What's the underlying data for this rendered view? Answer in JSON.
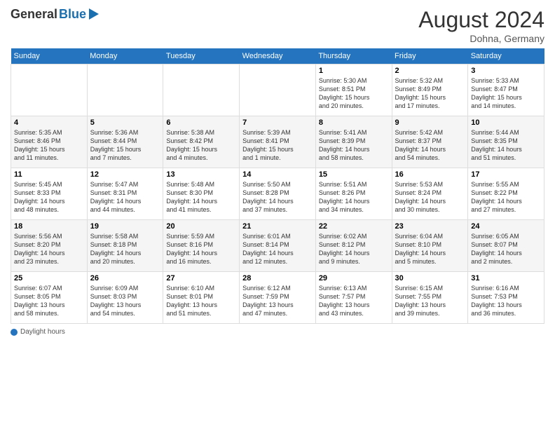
{
  "header": {
    "logo_general": "General",
    "logo_blue": "Blue",
    "title": "August 2024",
    "location": "Dohna, Germany"
  },
  "days_of_week": [
    "Sunday",
    "Monday",
    "Tuesday",
    "Wednesday",
    "Thursday",
    "Friday",
    "Saturday"
  ],
  "weeks": [
    [
      {
        "day": "",
        "info": ""
      },
      {
        "day": "",
        "info": ""
      },
      {
        "day": "",
        "info": ""
      },
      {
        "day": "",
        "info": ""
      },
      {
        "day": "1",
        "info": "Sunrise: 5:30 AM\nSunset: 8:51 PM\nDaylight: 15 hours\nand 20 minutes."
      },
      {
        "day": "2",
        "info": "Sunrise: 5:32 AM\nSunset: 8:49 PM\nDaylight: 15 hours\nand 17 minutes."
      },
      {
        "day": "3",
        "info": "Sunrise: 5:33 AM\nSunset: 8:47 PM\nDaylight: 15 hours\nand 14 minutes."
      }
    ],
    [
      {
        "day": "4",
        "info": "Sunrise: 5:35 AM\nSunset: 8:46 PM\nDaylight: 15 hours\nand 11 minutes."
      },
      {
        "day": "5",
        "info": "Sunrise: 5:36 AM\nSunset: 8:44 PM\nDaylight: 15 hours\nand 7 minutes."
      },
      {
        "day": "6",
        "info": "Sunrise: 5:38 AM\nSunset: 8:42 PM\nDaylight: 15 hours\nand 4 minutes."
      },
      {
        "day": "7",
        "info": "Sunrise: 5:39 AM\nSunset: 8:41 PM\nDaylight: 15 hours\nand 1 minute."
      },
      {
        "day": "8",
        "info": "Sunrise: 5:41 AM\nSunset: 8:39 PM\nDaylight: 14 hours\nand 58 minutes."
      },
      {
        "day": "9",
        "info": "Sunrise: 5:42 AM\nSunset: 8:37 PM\nDaylight: 14 hours\nand 54 minutes."
      },
      {
        "day": "10",
        "info": "Sunrise: 5:44 AM\nSunset: 8:35 PM\nDaylight: 14 hours\nand 51 minutes."
      }
    ],
    [
      {
        "day": "11",
        "info": "Sunrise: 5:45 AM\nSunset: 8:33 PM\nDaylight: 14 hours\nand 48 minutes."
      },
      {
        "day": "12",
        "info": "Sunrise: 5:47 AM\nSunset: 8:31 PM\nDaylight: 14 hours\nand 44 minutes."
      },
      {
        "day": "13",
        "info": "Sunrise: 5:48 AM\nSunset: 8:30 PM\nDaylight: 14 hours\nand 41 minutes."
      },
      {
        "day": "14",
        "info": "Sunrise: 5:50 AM\nSunset: 8:28 PM\nDaylight: 14 hours\nand 37 minutes."
      },
      {
        "day": "15",
        "info": "Sunrise: 5:51 AM\nSunset: 8:26 PM\nDaylight: 14 hours\nand 34 minutes."
      },
      {
        "day": "16",
        "info": "Sunrise: 5:53 AM\nSunset: 8:24 PM\nDaylight: 14 hours\nand 30 minutes."
      },
      {
        "day": "17",
        "info": "Sunrise: 5:55 AM\nSunset: 8:22 PM\nDaylight: 14 hours\nand 27 minutes."
      }
    ],
    [
      {
        "day": "18",
        "info": "Sunrise: 5:56 AM\nSunset: 8:20 PM\nDaylight: 14 hours\nand 23 minutes."
      },
      {
        "day": "19",
        "info": "Sunrise: 5:58 AM\nSunset: 8:18 PM\nDaylight: 14 hours\nand 20 minutes."
      },
      {
        "day": "20",
        "info": "Sunrise: 5:59 AM\nSunset: 8:16 PM\nDaylight: 14 hours\nand 16 minutes."
      },
      {
        "day": "21",
        "info": "Sunrise: 6:01 AM\nSunset: 8:14 PM\nDaylight: 14 hours\nand 12 minutes."
      },
      {
        "day": "22",
        "info": "Sunrise: 6:02 AM\nSunset: 8:12 PM\nDaylight: 14 hours\nand 9 minutes."
      },
      {
        "day": "23",
        "info": "Sunrise: 6:04 AM\nSunset: 8:10 PM\nDaylight: 14 hours\nand 5 minutes."
      },
      {
        "day": "24",
        "info": "Sunrise: 6:05 AM\nSunset: 8:07 PM\nDaylight: 14 hours\nand 2 minutes."
      }
    ],
    [
      {
        "day": "25",
        "info": "Sunrise: 6:07 AM\nSunset: 8:05 PM\nDaylight: 13 hours\nand 58 minutes."
      },
      {
        "day": "26",
        "info": "Sunrise: 6:09 AM\nSunset: 8:03 PM\nDaylight: 13 hours\nand 54 minutes."
      },
      {
        "day": "27",
        "info": "Sunrise: 6:10 AM\nSunset: 8:01 PM\nDaylight: 13 hours\nand 51 minutes."
      },
      {
        "day": "28",
        "info": "Sunrise: 6:12 AM\nSunset: 7:59 PM\nDaylight: 13 hours\nand 47 minutes."
      },
      {
        "day": "29",
        "info": "Sunrise: 6:13 AM\nSunset: 7:57 PM\nDaylight: 13 hours\nand 43 minutes."
      },
      {
        "day": "30",
        "info": "Sunrise: 6:15 AM\nSunset: 7:55 PM\nDaylight: 13 hours\nand 39 minutes."
      },
      {
        "day": "31",
        "info": "Sunrise: 6:16 AM\nSunset: 7:53 PM\nDaylight: 13 hours\nand 36 minutes."
      }
    ]
  ],
  "footer": {
    "label": "Daylight hours"
  }
}
